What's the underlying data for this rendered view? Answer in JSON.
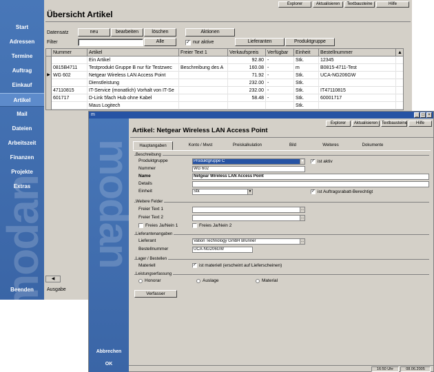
{
  "back_window": {
    "sidebar": {
      "items": [
        "Start",
        "Adressen",
        "Termine",
        "Auftrag",
        "Einkauf",
        "Artikel",
        "Mail",
        "Dateien",
        "Arbeitszeit",
        "Finanzen",
        "Projekte",
        "Extras"
      ],
      "active": "Artikel",
      "quit_label": "Beenden",
      "watermark": "modan"
    },
    "topbar_buttons": [
      "Explorer",
      "Aktualisieren",
      "Textbausteine",
      "Hilfe"
    ],
    "title": "Übersicht Artikel",
    "datensatz_label": "Datensatz",
    "datensatz_buttons": [
      "neu",
      "bearbeiten",
      "löschen"
    ],
    "actions_button": "Aktionen",
    "filter_label": "Filter",
    "filter_value": "",
    "filter_select": "Alle",
    "only_active_label": "nur aktive",
    "only_active_checked": true,
    "lieferanten_button": "Lieferanten",
    "produktgruppe_button": "Produktgruppe",
    "columns": [
      "Nummer",
      "Artikel",
      "Freier Text 1",
      "Verkaufspreis",
      "Verfügbar",
      "Einheit",
      "Bestellnummer"
    ],
    "rows": [
      {
        "nummer": "",
        "artikel": "Ein Artikel",
        "freitext": "",
        "preis": "92.80",
        "verf": "-",
        "einheit": "Stk.",
        "bestell": "12345",
        "selected": false
      },
      {
        "nummer": "0815B4711",
        "artikel": "Testprodukt Gruppe B nur für Testzwec",
        "freitext": "Beschreibung des A",
        "preis": "160.08",
        "verf": "-",
        "einheit": "m",
        "bestell": "B0815-4711-Test",
        "selected": false
      },
      {
        "nummer": "WG 602",
        "artikel": "Netgear Wireless LAN Access Point",
        "freitext": "",
        "preis": "71.92",
        "verf": "-",
        "einheit": "Stk.",
        "bestell": "UCA-NG206GW",
        "selected": true
      },
      {
        "nummer": "",
        "artikel": "Dienstleistung",
        "freitext": "",
        "preis": "232.00",
        "verf": "-",
        "einheit": "Stk.",
        "bestell": "",
        "selected": false
      },
      {
        "nummer": "47110815",
        "artikel": "IT-Service (monatlich) Vorhalt von IT-Se",
        "freitext": "",
        "preis": "232.00",
        "verf": "-",
        "einheit": "Stk.",
        "bestell": "IT47110815",
        "selected": false
      },
      {
        "nummer": "601717",
        "artikel": "D-Link 5fach Hub ohne Kabel",
        "freitext": "",
        "preis": "58.48",
        "verf": "-",
        "einheit": "Stk.",
        "bestell": "60001717",
        "selected": false
      },
      {
        "nummer": "",
        "artikel": "Maus Logitech",
        "freitext": "",
        "preis": "",
        "verf": "",
        "einheit": "Stk.",
        "bestell": "",
        "selected": false
      }
    ],
    "ausgabe_label": "Ausgabe"
  },
  "front_window": {
    "title_icon": "m",
    "topbar_buttons": [
      "Explorer",
      "Aktualisieren",
      "Textbausteine",
      "Hilfe"
    ],
    "heading": "Artikel: Netgear Wireless LAN Access Point",
    "tabs": [
      "Hauptangaben",
      "Konto / Mwst",
      "Preiskalkulation",
      "Bild",
      "Weiteres",
      "Dokumente"
    ],
    "active_tab": "Hauptangaben",
    "beschreibung": {
      "title": "Beschreibung",
      "produktgruppe_label": "Produktgruppe",
      "produktgruppe_value": "Produktgruppe C",
      "ist_aktiv_label": "ist aktiv",
      "nummer_label": "Nummer",
      "nummer_value": "WG 602",
      "name_label": "Name",
      "name_value": "Netgear Wireless LAN Access Point",
      "details_label": "Details",
      "details_value": "",
      "einheit_label": "Einheit",
      "einheit_value": "Stk",
      "rabatt_label": "ist Auftragsrabatt-Berechtigt"
    },
    "weitere": {
      "title": "Weitere Felder",
      "freitext1_label": "Freier Text 1",
      "freitext2_label": "Freier Text 2",
      "jn1_label": "Freies Ja/Nein 1",
      "jn2_label": "Freies Ja/Nein 2"
    },
    "lieferant": {
      "title": "Lieferantenangaben",
      "lieferant_label": "Lieferant",
      "lieferant_value": "Vation Technology GmbH Brunner",
      "bestell_label": "Bestellnummer",
      "bestell_value": "UCA-NG206GW"
    },
    "lager": {
      "title": "Lager / Bestellen",
      "material_label": "Materiell",
      "materiell_text": "ist materiell (erscheint auf Lieferscheinen)"
    },
    "leistung": {
      "title": "Leistungserfassung",
      "options": [
        "Honorar",
        "Auslage",
        "Material"
      ]
    },
    "verfasser_button": "Verfasser",
    "sidebar": {
      "watermark": "modan",
      "abbrechen": "Abbrechen",
      "ok": "OK"
    },
    "status_time": "16:50 Uhr",
    "status_date": "08.06.2005"
  }
}
